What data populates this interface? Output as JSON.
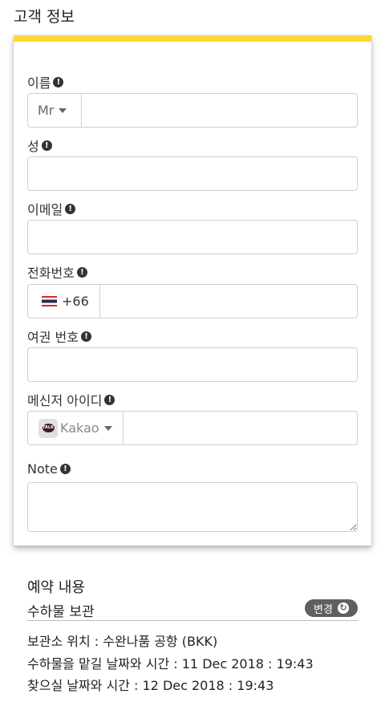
{
  "section_title": "고객 정보",
  "form": {
    "first_name": {
      "label": "이름",
      "title_value": "Mr"
    },
    "last_name": {
      "label": "성"
    },
    "email": {
      "label": "이메일"
    },
    "phone": {
      "label": "전화번호",
      "country_code": "+66",
      "flag_icon": "thailand-flag-icon"
    },
    "passport": {
      "label": "여권 번호"
    },
    "messenger": {
      "label": "메신저 아이디",
      "selected": "Kakao",
      "logo_icon": "kakao-talk-icon",
      "logo_text": "TALK"
    },
    "note": {
      "label": "Note"
    }
  },
  "info_glyph": "!",
  "summary": {
    "title": "예약 내용",
    "service": "수하물 보관",
    "change_label": "변경",
    "location_label": "보관소 위치",
    "location_value": " : 수완나품 공항 (BKK)",
    "dropoff_label": "수하물을 맡길 날짜와 시간",
    "dropoff_value": " : 11 Dec 2018 : 19:43",
    "pickup_label": "찾으실 날짜와 시간",
    "pickup_value": " : 12 Dec 2018 : 19:43"
  },
  "colors": {
    "accent": "#fdd835",
    "button": "#5f5f5f",
    "border": "#cfcfcf"
  }
}
